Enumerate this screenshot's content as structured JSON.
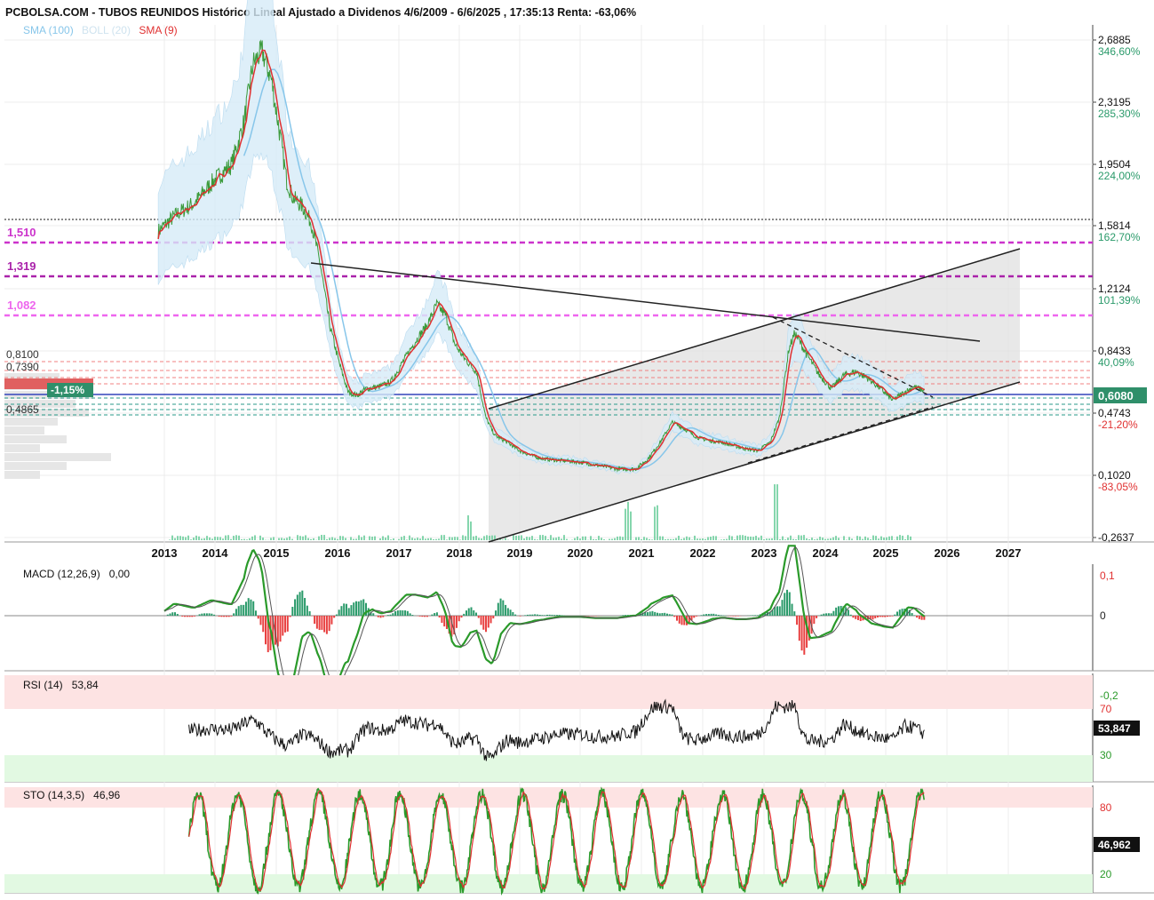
{
  "header": {
    "title": "PCBOLSA.COM - TUBOS REUNIDOS Histórico Lineal Ajustado a Dividenos 4/6/2009 - 6/6/2025 , 17:35:13 Renta: -63,06%",
    "legend": [
      {
        "label": "SMA (100)",
        "color": "#87c6ea"
      },
      {
        "label": "BOLL (20)",
        "color": "#cfe3ef"
      },
      {
        "label": "SMA (9)",
        "color": "#e03030"
      }
    ]
  },
  "chart_data": [
    {
      "type": "line",
      "panel": "price",
      "x_labels": [
        "2013",
        "2014",
        "2015",
        "2016",
        "2017",
        "2018",
        "2019",
        "2020",
        "2021",
        "2022",
        "2023",
        "2024",
        "2025",
        "2026",
        "2027"
      ],
      "y_scale": "log",
      "y_ticks": [
        {
          "price": "2,6885",
          "pct": "346,60%",
          "value": 2.6885
        },
        {
          "price": "2,3195",
          "pct": "285,30%",
          "value": 2.3195
        },
        {
          "price": "1,9504",
          "pct": "224,00%",
          "value": 1.9504
        },
        {
          "price": "1,5814",
          "pct": "162,70%",
          "value": 1.5814
        },
        {
          "price": "1,2124",
          "pct": "101,39%",
          "value": 1.2124
        },
        {
          "price": "0,8433",
          "pct": "40,09%",
          "value": 0.8433
        },
        {
          "price": "0,4743",
          "pct": "-21,20%",
          "value": 0.4743
        },
        {
          "price": "0,1020",
          "pct": "-83,05%",
          "value": 0.102
        },
        {
          "price": "-0,2637",
          "pct": "",
          "value": -0.2637
        }
      ],
      "last_price": "0,6080",
      "change_badge": "-1,15%",
      "levels": [
        {
          "label": "1,510",
          "value": 1.51,
          "color": "#cc33cc"
        },
        {
          "label": "1,319",
          "value": 1.319,
          "color": "#aa22aa"
        },
        {
          "label": "1,082",
          "value": 1.082,
          "color": "#ee66ee"
        }
      ],
      "left_labels": [
        "0,8100",
        "0,7390",
        "0,4865"
      ],
      "series_close": [
        [
          2012.9,
          1.55
        ],
        [
          2013.2,
          1.65
        ],
        [
          2013.5,
          1.72
        ],
        [
          2013.8,
          1.85
        ],
        [
          2014.1,
          1.95
        ],
        [
          2014.3,
          2.2
        ],
        [
          2014.45,
          2.55
        ],
        [
          2014.6,
          2.62
        ],
        [
          2014.75,
          2.45
        ],
        [
          2014.9,
          2.1
        ],
        [
          2015.0,
          1.85
        ],
        [
          2015.1,
          1.75
        ],
        [
          2015.25,
          1.7
        ],
        [
          2015.4,
          1.6
        ],
        [
          2015.55,
          1.35
        ],
        [
          2015.7,
          1.0
        ],
        [
          2015.85,
          0.78
        ],
        [
          2016.0,
          0.6
        ],
        [
          2016.15,
          0.58
        ],
        [
          2016.3,
          0.62
        ],
        [
          2016.5,
          0.63
        ],
        [
          2016.7,
          0.66
        ],
        [
          2016.9,
          0.78
        ],
        [
          2017.1,
          0.9
        ],
        [
          2017.3,
          1.0
        ],
        [
          2017.45,
          1.12
        ],
        [
          2017.6,
          1.05
        ],
        [
          2017.75,
          0.88
        ],
        [
          2017.9,
          0.8
        ],
        [
          2018.1,
          0.72
        ],
        [
          2018.25,
          0.45
        ],
        [
          2018.4,
          0.34
        ],
        [
          2018.6,
          0.3
        ],
        [
          2018.8,
          0.25
        ],
        [
          2019.0,
          0.22
        ],
        [
          2019.2,
          0.2
        ],
        [
          2019.5,
          0.19
        ],
        [
          2019.8,
          0.18
        ],
        [
          2020.1,
          0.16
        ],
        [
          2020.4,
          0.14
        ],
        [
          2020.7,
          0.14
        ],
        [
          2020.9,
          0.2
        ],
        [
          2021.1,
          0.3
        ],
        [
          2021.3,
          0.42
        ],
        [
          2021.5,
          0.38
        ],
        [
          2021.7,
          0.33
        ],
        [
          2021.9,
          0.31
        ],
        [
          2022.1,
          0.3
        ],
        [
          2022.3,
          0.28
        ],
        [
          2022.5,
          0.26
        ],
        [
          2022.7,
          0.25
        ],
        [
          2022.9,
          0.3
        ],
        [
          2023.05,
          0.45
        ],
        [
          2023.2,
          0.85
        ],
        [
          2023.3,
          0.95
        ],
        [
          2023.5,
          0.82
        ],
        [
          2023.7,
          0.7
        ],
        [
          2023.9,
          0.62
        ],
        [
          2024.1,
          0.7
        ],
        [
          2024.3,
          0.72
        ],
        [
          2024.5,
          0.68
        ],
        [
          2024.7,
          0.62
        ],
        [
          2024.9,
          0.55
        ],
        [
          2025.1,
          0.6
        ],
        [
          2025.25,
          0.63
        ],
        [
          2025.4,
          0.61
        ]
      ]
    },
    {
      "type": "line",
      "panel": "macd",
      "title": "MACD (12,26,9)",
      "value": "0,00",
      "y_ticks": [
        {
          "label": "0,1",
          "value": 0.1,
          "color": "#e03030"
        },
        {
          "label": "0",
          "value": 0,
          "color": "#222222"
        },
        {
          "label": "-0,2",
          "value": -0.2,
          "color": "#2a9a2a"
        }
      ]
    },
    {
      "type": "line",
      "panel": "rsi",
      "title": "RSI (14)",
      "value": "53,84",
      "last_value": "53,847",
      "y_ticks": [
        {
          "label": "70",
          "value": 70,
          "color": "#e03030"
        },
        {
          "label": "30",
          "value": 30,
          "color": "#2a9a2a"
        }
      ]
    },
    {
      "type": "line",
      "panel": "sto",
      "title": "STO (14,3,5)",
      "value": "46,96",
      "last_value": "46,962",
      "y_ticks": [
        {
          "label": "80",
          "value": 80,
          "color": "#e03030"
        },
        {
          "label": "20",
          "value": 20,
          "color": "#2a9a2a"
        }
      ]
    }
  ],
  "colors": {
    "ma100": "#87c6ea",
    "boll_fill": "#d6ebf8",
    "sma9": "#e03030",
    "price": "#3a9a3a",
    "trend": "#222222",
    "overbought_fill": "#fde3e3",
    "oversold_fill": "#e2f9e2",
    "badge_green": "#2f8f6a"
  }
}
